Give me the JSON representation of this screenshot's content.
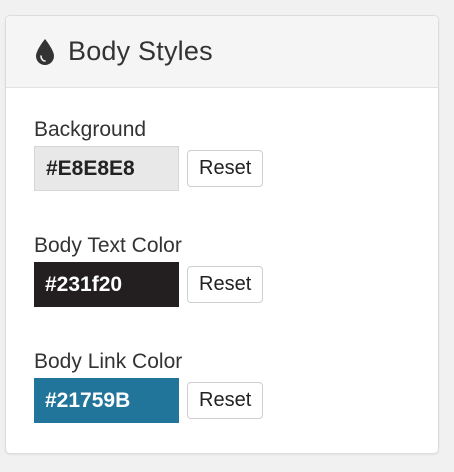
{
  "panel": {
    "title": "Body Styles",
    "icon": "drop-icon"
  },
  "fields": [
    {
      "label": "Background",
      "value": "#E8E8E8",
      "swatch_color": "#E8E8E8",
      "text_color": "#222222",
      "reset_label": "Reset"
    },
    {
      "label": "Body Text Color",
      "value": "#231f20",
      "swatch_color": "#231f20",
      "text_color": "#ffffff",
      "reset_label": "Reset"
    },
    {
      "label": "Body Link Color",
      "value": "#21759B",
      "swatch_color": "#21759B",
      "text_color": "#ffffff",
      "reset_label": "Reset"
    }
  ]
}
